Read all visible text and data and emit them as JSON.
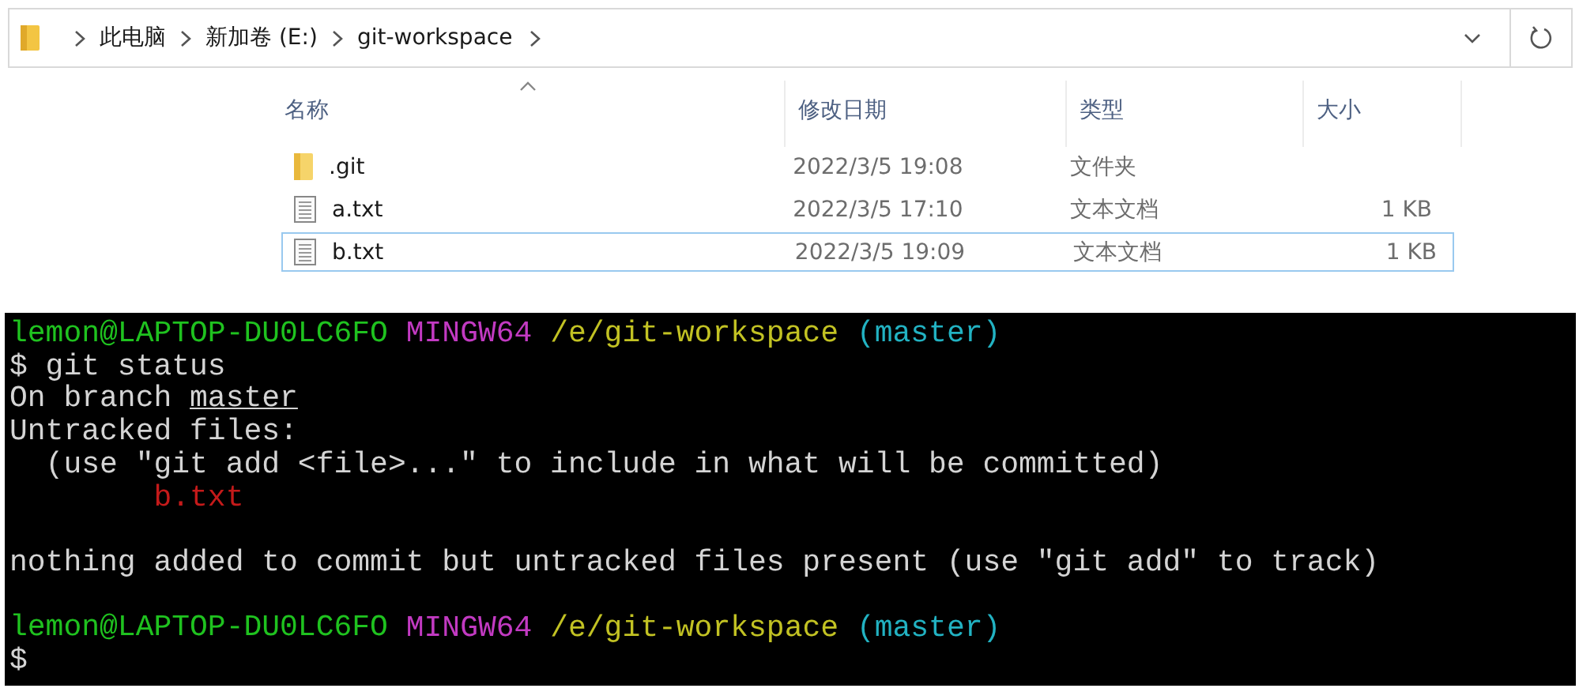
{
  "address_bar": {
    "breadcrumbs": [
      "此电脑",
      "新加卷 (E:)",
      "git-workspace"
    ]
  },
  "file_list": {
    "columns": [
      {
        "label": "名称",
        "sorted": true
      },
      {
        "label": "修改日期",
        "sorted": false
      },
      {
        "label": "类型",
        "sorted": false
      },
      {
        "label": "大小",
        "sorted": false
      }
    ],
    "rows": [
      {
        "kind": "folder",
        "name": ".git",
        "modified": "2022/3/5 19:08",
        "type": "文件夹",
        "selected": false
      },
      {
        "kind": "file",
        "name": "a.txt",
        "modified": "2022/3/5 17:10",
        "type": "文本文档",
        "size": "1 KB",
        "selected": false
      },
      {
        "kind": "file",
        "name": "b.txt",
        "modified": "2022/3/5 19:09",
        "type": "文本文档",
        "size": "1 KB",
        "selected": true
      }
    ]
  },
  "terminal": {
    "lines": [
      {
        "blank_before": false,
        "segments": [
          {
            "kind": "user",
            "text": "lemon@LAPTOP-DU0LC6FO"
          },
          {
            "kind": "host",
            "text": "MINGW64"
          },
          {
            "kind": "path",
            "text": "/e/git-workspace"
          },
          {
            "kind": "branch",
            "text": "(master)"
          }
        ]
      },
      {
        "blank_before": false,
        "segments": [
          {
            "kind": "plain",
            "text": "$ git status"
          }
        ]
      },
      {
        "blank_before": false,
        "segments": [
          {
            "kind": "plain",
            "text": "On branch"
          },
          {
            "kind": "underlined",
            "text": "master"
          }
        ]
      },
      {
        "blank_before": false,
        "segments": [
          {
            "kind": "plain",
            "text": "Untracked files:"
          }
        ]
      },
      {
        "blank_before": false,
        "segments": [
          {
            "kind": "plain",
            "text": "  (use \"git add <file>...\" to include in what will be committed)"
          }
        ]
      },
      {
        "blank_before": false,
        "segments": [
          {
            "kind": "untracked",
            "text": "        b.txt"
          }
        ]
      },
      {
        "blank_before": true,
        "segments": [
          {
            "kind": "plain",
            "text": "nothing added to commit but untracked files present (use \"git add\" to track)"
          }
        ]
      },
      {
        "blank_before": true,
        "segments": [
          {
            "kind": "user",
            "text": "lemon@LAPTOP-DU0LC6FO"
          },
          {
            "kind": "host",
            "text": "MINGW64"
          },
          {
            "kind": "path",
            "text": "/e/git-workspace"
          },
          {
            "kind": "branch",
            "text": "(master)"
          }
        ]
      },
      {
        "blank_before": false,
        "segments": [
          {
            "kind": "plain",
            "text": "$"
          }
        ]
      }
    ]
  }
}
